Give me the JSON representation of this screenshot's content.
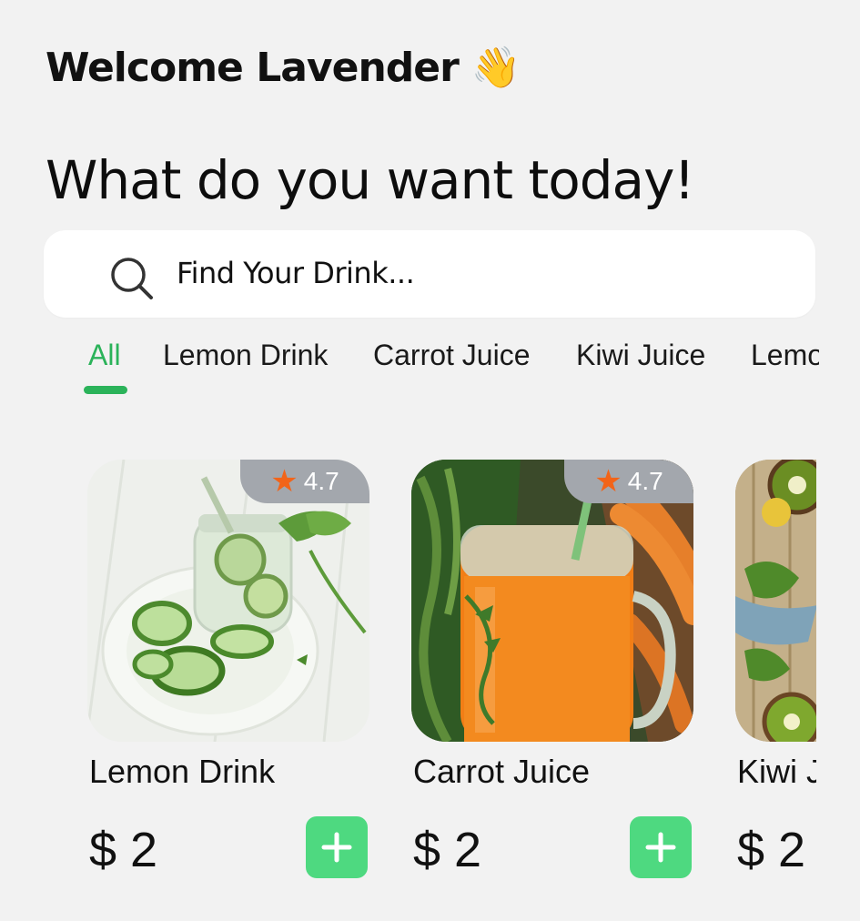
{
  "header": {
    "welcome": "Welcome Lavender",
    "wave_icon": "👋",
    "headline": "What do you want today!"
  },
  "search": {
    "icon": "search-icon",
    "placeholder": "Find Your Drink..."
  },
  "tabs": [
    {
      "label": "All",
      "active": true
    },
    {
      "label": "Lemon Drink",
      "active": false
    },
    {
      "label": "Carrot Juice",
      "active": false
    },
    {
      "label": "Kiwi Juice",
      "active": false
    },
    {
      "label": "Lemo",
      "active": false
    }
  ],
  "products": [
    {
      "name": "Lemon Drink",
      "rating": "4.7",
      "price": "$ 2",
      "image": "cucumber-lemon-water-photo"
    },
    {
      "name": "Carrot Juice",
      "rating": "4.7",
      "price": "$ 2",
      "image": "carrot-juice-jar-photo"
    },
    {
      "name": "Kiwi J",
      "price": "$ 2",
      "image": "kiwi-fruit-photo"
    }
  ],
  "colors": {
    "accent": "#2bb35a",
    "add_button": "#4ed980",
    "rating_star": "#f26419",
    "rating_badge": "#a3a7ad",
    "background": "#f2f2f2"
  }
}
